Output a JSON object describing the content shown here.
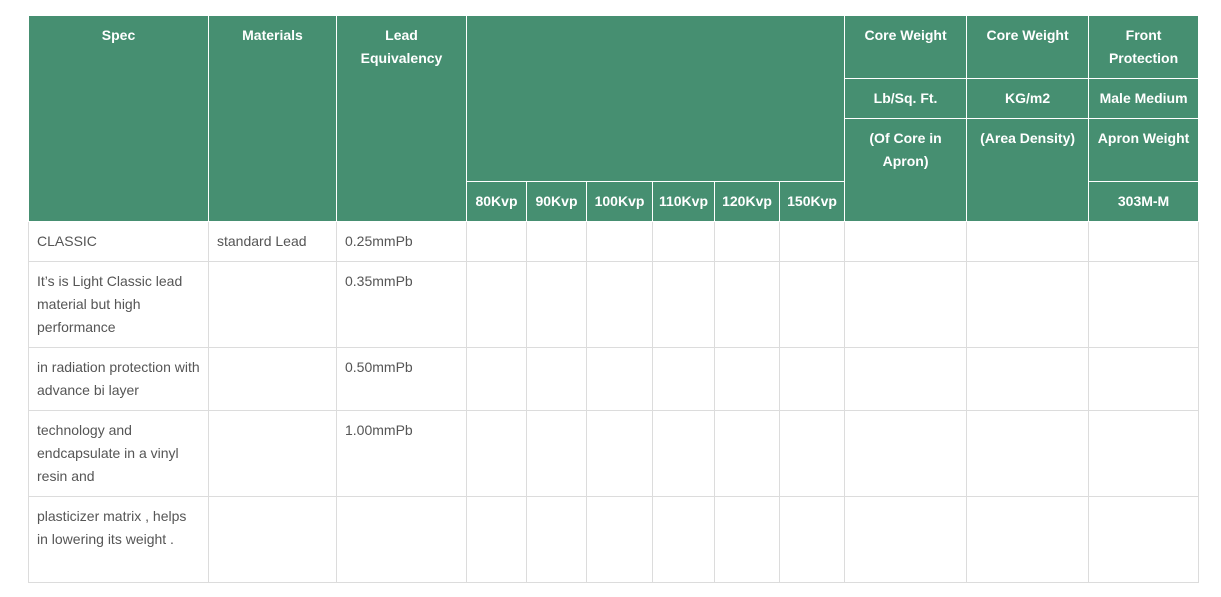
{
  "table": {
    "headers": {
      "spec": "Spec",
      "materials": "Materials",
      "lead_equivalency": "Lead Equivalency",
      "core_weight_1": "Core Weight",
      "core_weight_2": "Core Weight",
      "front_protection": "Front Protection",
      "lb_sq_ft": "Lb/Sq. Ft.",
      "kg_m2": "KG/m2",
      "male_medium": "Male Medium",
      "of_core_in_apron": "(Of Core in Apron)",
      "area_density": "(Area Density)",
      "apron_weight": "Apron Weight",
      "model": "303M-M",
      "kvp": [
        "80Kvp",
        "90Kvp",
        "100Kvp",
        "110Kvp",
        "120Kvp",
        "150Kvp"
      ]
    },
    "rows": [
      {
        "spec": "CLASSIC",
        "materials": "standard Lead",
        "lead": "0.25mmPb"
      },
      {
        "spec": "It’s is Light Classic lead material but high performance",
        "materials": "",
        "lead": "0.35mmPb"
      },
      {
        "spec": "in radiation protection with advance bi layer",
        "materials": "",
        "lead": "0.50mmPb"
      },
      {
        "spec": "technology and endcapsulate in a vinyl resin and",
        "materials": "",
        "lead": "1.00mmPb"
      },
      {
        "spec": "plasticizer matrix , helps in lowering its weight .",
        "materials": "",
        "lead": ""
      }
    ]
  }
}
